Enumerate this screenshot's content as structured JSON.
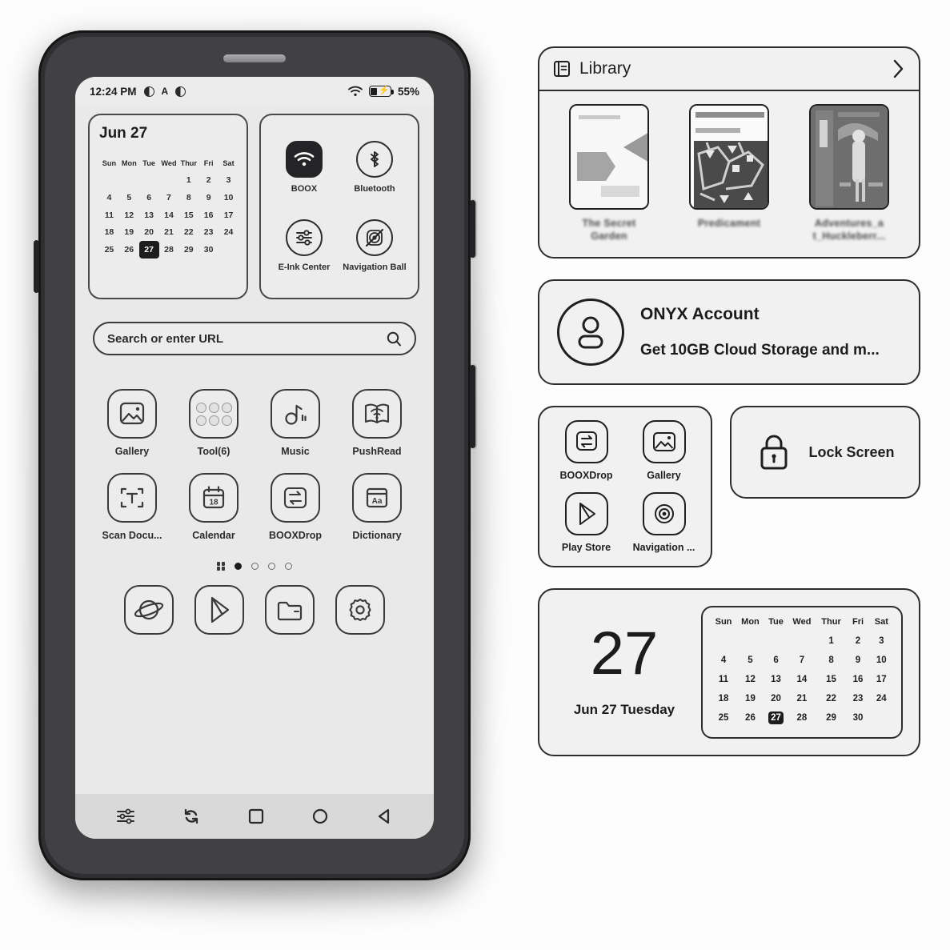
{
  "statusbar": {
    "time": "12:24 PM",
    "icon_contrast_1": "contrast-icon",
    "icon_letter": "A",
    "icon_contrast_2": "contrast-icon",
    "icon_wifi": "wifi-icon",
    "icon_battery": "battery-charging-icon",
    "battery_percent": "55%"
  },
  "calendar_widget": {
    "title": "Jun 27",
    "weekdays": [
      "Sun",
      "Mon",
      "Tue",
      "Wed",
      "Thur",
      "Fri",
      "Sat"
    ],
    "weeks": [
      [
        "",
        "",
        "",
        "",
        "1",
        "2",
        "3"
      ],
      [
        "4",
        "5",
        "6",
        "7",
        "8",
        "9",
        "10"
      ],
      [
        "11",
        "12",
        "13",
        "14",
        "15",
        "16",
        "17"
      ],
      [
        "18",
        "19",
        "20",
        "21",
        "22",
        "23",
        "24"
      ],
      [
        "25",
        "26",
        "27",
        "28",
        "29",
        "30",
        ""
      ]
    ],
    "today": "27"
  },
  "toggles": [
    {
      "label": "BOOX",
      "icon": "wifi-icon",
      "active": true
    },
    {
      "label": "Bluetooth",
      "icon": "bluetooth-icon",
      "active": false
    },
    {
      "label": "E-Ink Center",
      "icon": "sliders-icon",
      "active": false
    },
    {
      "label": "Navigation Ball",
      "icon": "navigation-ball-disabled-icon",
      "active": false
    }
  ],
  "search": {
    "placeholder": "Search or enter URL",
    "icon": "search-icon"
  },
  "apps": [
    {
      "label": "Gallery",
      "icon": "gallery-icon"
    },
    {
      "label": "Tool(6)",
      "icon": "folder-tools-icon"
    },
    {
      "label": "Music",
      "icon": "music-note-icon"
    },
    {
      "label": "PushRead",
      "icon": "pushread-icon"
    },
    {
      "label": "Scan Docu...",
      "icon": "scan-document-icon"
    },
    {
      "label": "Calendar",
      "icon": "calendar-icon"
    },
    {
      "label": "BOOXDrop",
      "icon": "booxdrop-icon"
    },
    {
      "label": "Dictionary",
      "icon": "dictionary-icon"
    }
  ],
  "calendar_app_day": "18",
  "pager": {
    "grid_icon": "app-drawer-icon",
    "dots": 4,
    "active_index": 0
  },
  "dock": [
    {
      "label": "Browser",
      "icon": "browser-planet-icon"
    },
    {
      "label": "Play Store",
      "icon": "play-store-icon"
    },
    {
      "label": "File Manager",
      "icon": "folder-icon"
    },
    {
      "label": "Settings",
      "icon": "gear-icon"
    }
  ],
  "navbar": [
    {
      "name": "eink-settings",
      "icon": "sliders-icon"
    },
    {
      "name": "refresh",
      "icon": "refresh-icon"
    },
    {
      "name": "recents",
      "icon": "square-icon"
    },
    {
      "name": "home",
      "icon": "circle-icon"
    },
    {
      "name": "back",
      "icon": "triangle-back-icon"
    }
  ],
  "library": {
    "title": "Library",
    "icon": "book-list-icon",
    "chevron": "chevron-right-icon",
    "books": [
      {
        "title": "The Secret\nGarden"
      },
      {
        "title": "Predicament"
      },
      {
        "title": "Adventures_a\nt_Huckleberr..."
      }
    ]
  },
  "account": {
    "icon": "person-circle-icon",
    "name": "ONYX Account",
    "subtitle": "Get 10GB Cloud Storage and m..."
  },
  "shortcuts": [
    {
      "label": "BOOXDrop",
      "icon": "booxdrop-icon"
    },
    {
      "label": "Gallery",
      "icon": "gallery-icon"
    },
    {
      "label": "Play Store",
      "icon": "play-store-icon"
    },
    {
      "label": "Navigation ...",
      "icon": "navigation-ball-icon"
    }
  ],
  "lock_screen": {
    "label": "Lock Screen",
    "icon": "lock-icon"
  },
  "date_widget": {
    "day_number": "27",
    "date_label": "Jun 27 Tuesday",
    "weekdays": [
      "Sun",
      "Mon",
      "Tue",
      "Wed",
      "Thur",
      "Fri",
      "Sat"
    ],
    "weeks": [
      [
        "",
        "",
        "",
        "",
        "1",
        "2",
        "3"
      ],
      [
        "4",
        "5",
        "6",
        "7",
        "8",
        "9",
        "10"
      ],
      [
        "11",
        "12",
        "13",
        "14",
        "15",
        "16",
        "17"
      ],
      [
        "18",
        "19",
        "20",
        "21",
        "22",
        "23",
        "24"
      ],
      [
        "25",
        "26",
        "27",
        "28",
        "29",
        "30",
        ""
      ]
    ],
    "today": "27"
  },
  "colors": {
    "screen_bg": "#e9e9e9",
    "ink": "#1d1d1d",
    "bezel": "#2f2f31",
    "card_bg": "#f1f1f1"
  }
}
